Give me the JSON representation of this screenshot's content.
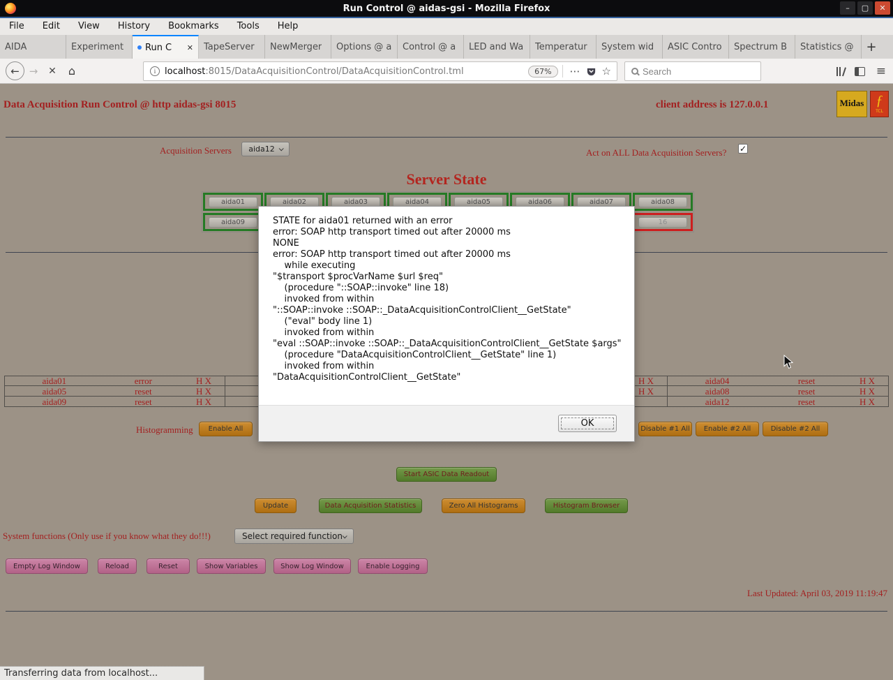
{
  "window": {
    "title": "Run Control @ aidas-gsi - Mozilla Firefox",
    "menubar": {
      "items": [
        "File",
        "Edit",
        "View",
        "History",
        "Bookmarks",
        "Tools",
        "Help"
      ]
    },
    "tabs": {
      "items": [
        {
          "label": "AIDA"
        },
        {
          "label": "Experiment"
        },
        {
          "label": "Run C",
          "active": true
        },
        {
          "label": "TapeServer"
        },
        {
          "label": "NewMerger"
        },
        {
          "label": "Options @ a"
        },
        {
          "label": "Control @ a"
        },
        {
          "label": "LED and Wa"
        },
        {
          "label": "Temperatur"
        },
        {
          "label": "System wid"
        },
        {
          "label": "ASIC Contro"
        },
        {
          "label": "Spectrum B"
        },
        {
          "label": "Statistics @"
        }
      ]
    },
    "navbar": {
      "url_host": "localhost",
      "url_path": ":8015/DataAcquisitionControl/DataAcquisitionControl.tml",
      "zoom_level": "67%",
      "search_placeholder": "Search"
    },
    "statusbar": {
      "text": "Transferring data from localhost..."
    }
  },
  "icons": {
    "back": "←",
    "forward": "→",
    "stop": "✕",
    "home": "⌂",
    "info": "i",
    "more": "⋯",
    "star": "☆",
    "menu": "≡",
    "new_tab": "+",
    "tab_close": "✕",
    "minimize": "–",
    "maximize": "▢",
    "close": "✕",
    "check": "✓",
    "loading_dot": "•",
    "feather": "ƒ"
  },
  "page": {
    "header_left": "Data Acquisition Run Control @ http aidas-gsi 8015",
    "header_right": "client address is 127.0.0.1",
    "logos": {
      "midas": "Midas",
      "tcl": "TCL"
    },
    "acq_servers_label": "Acquisition Servers",
    "acq_servers_value": "aida12",
    "act_on_all_label": "Act on ALL Data Acquisition Servers?",
    "server_state_title": "Server State",
    "server_grid": {
      "row1": [
        "aida01",
        "aida02",
        "aida03",
        "aida04",
        "aida05",
        "aida06",
        "aida07",
        "aida08"
      ],
      "row2_first": "aida09",
      "row2_last": "16"
    },
    "status_table": {
      "left": [
        {
          "name": "aida01",
          "state": "error",
          "hx": "H X"
        },
        {
          "name": "aida05",
          "state": "reset",
          "hx": "H X"
        },
        {
          "name": "aida09",
          "state": "reset",
          "hx": "H X"
        }
      ],
      "mid_hx": [
        "H X",
        "H X",
        ""
      ],
      "right": [
        {
          "name": "aida04",
          "state": "reset",
          "hx": "H X"
        },
        {
          "name": "aida08",
          "state": "reset",
          "hx": "H X"
        },
        {
          "name": "aida12",
          "state": "reset",
          "hx": "H X"
        }
      ]
    },
    "histogramming": {
      "label": "Histogramming",
      "enable_all": "Enable All",
      "disable1_all": "Disable #1 All",
      "enable2_all": "Enable #2 All",
      "disable2_all": "Disable #2 All"
    },
    "readout_button": "Start ASIC Data Readout",
    "action_buttons": {
      "update": "Update",
      "daq_stats": "Data Acquisition Statistics",
      "zero_histograms": "Zero All Histograms",
      "histogram_browser": "Histogram Browser"
    },
    "system_functions": {
      "label": "System functions (Only use if you know what they do!!!)",
      "select_value": "Select required function"
    },
    "log_buttons": [
      "Empty Log Window",
      "Reload",
      "Reset",
      "Show Variables",
      "Show Log Window",
      "Enable Logging"
    ],
    "last_updated": "Last Updated: April 03, 2019 11:19:47"
  },
  "dialog": {
    "lines": [
      "STATE for aida01 returned with an error",
      "error: SOAP http transport timed out after 20000 ms",
      "NONE",
      "error: SOAP http transport timed out after 20000 ms",
      "    while executing",
      "\"$transport $procVarName $url $req\"",
      "    (procedure \"::SOAP::invoke\" line 18)",
      "    invoked from within",
      "\"::SOAP::invoke ::SOAP::_DataAcquisitionControlClient__GetState\"",
      "    (\"eval\" body line 1)",
      "    invoked from within",
      "\"eval ::SOAP::invoke ::SOAP::_DataAcquisitionControlClient__GetState $args\"",
      "    (procedure \"DataAcquisitionControlClient__GetState\" line 1)",
      "    invoked from within",
      "\"DataAcquisitionControlClient__GetState\""
    ],
    "ok_label": "OK"
  },
  "colors": {
    "accent_red": "#a32020",
    "green_border": "#257a25",
    "red_border": "#cc1f1f",
    "orange_button": "#c08026",
    "green_button": "#5f8a33",
    "pink_button": "#bf7496",
    "page_background": "#9a9084"
  }
}
